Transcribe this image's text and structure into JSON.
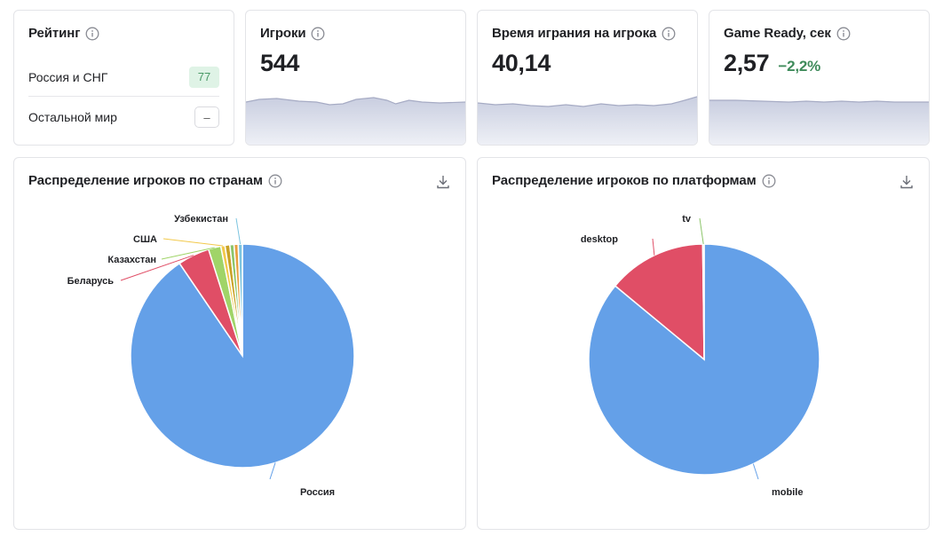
{
  "rating": {
    "title": "Рейтинг",
    "rows": [
      {
        "label": "Россия и СНГ",
        "value": "77"
      },
      {
        "label": "Остальной мир",
        "value": "–"
      }
    ]
  },
  "players": {
    "title": "Игроки",
    "value": "544"
  },
  "playtime": {
    "title": "Время играния на игрока",
    "value": "40,14"
  },
  "game_ready": {
    "title": "Game Ready, сек",
    "value": "2,57",
    "delta": "−2,2%",
    "delta_color": "#3f8b5b"
  },
  "countries": {
    "title": "Распределение игроков по странам"
  },
  "platforms": {
    "title": "Распределение игроков по платформам"
  },
  "chart_data": [
    {
      "type": "pie",
      "title": "Распределение игроков по странам",
      "slices": [
        {
          "label": "Россия",
          "value": 90.5,
          "color": "#64a0e8"
        },
        {
          "label": "Беларусь",
          "value": 4.6,
          "color": "#e04e66"
        },
        {
          "label": "Казахстан",
          "value": 1.8,
          "color": "#a0d468"
        },
        {
          "label": "США",
          "value": 0.6,
          "color": "#f2c94c"
        },
        {
          "label": "",
          "value": 0.7,
          "color": "#c9a227"
        },
        {
          "label": "",
          "value": 0.6,
          "color": "#8cc56a"
        },
        {
          "label": "",
          "value": 0.6,
          "color": "#e8a040"
        },
        {
          "label": "Узбекистан",
          "value": 0.6,
          "color": "#7cc4e0"
        }
      ]
    },
    {
      "type": "pie",
      "title": "Распределение игроков по платформам",
      "slices": [
        {
          "label": "mobile",
          "value": 86,
          "color": "#64a0e8"
        },
        {
          "label": "desktop",
          "value": 13.8,
          "color": "#e04e66"
        },
        {
          "label": "tv",
          "value": 0.2,
          "color": "#8cc56a"
        }
      ]
    }
  ]
}
